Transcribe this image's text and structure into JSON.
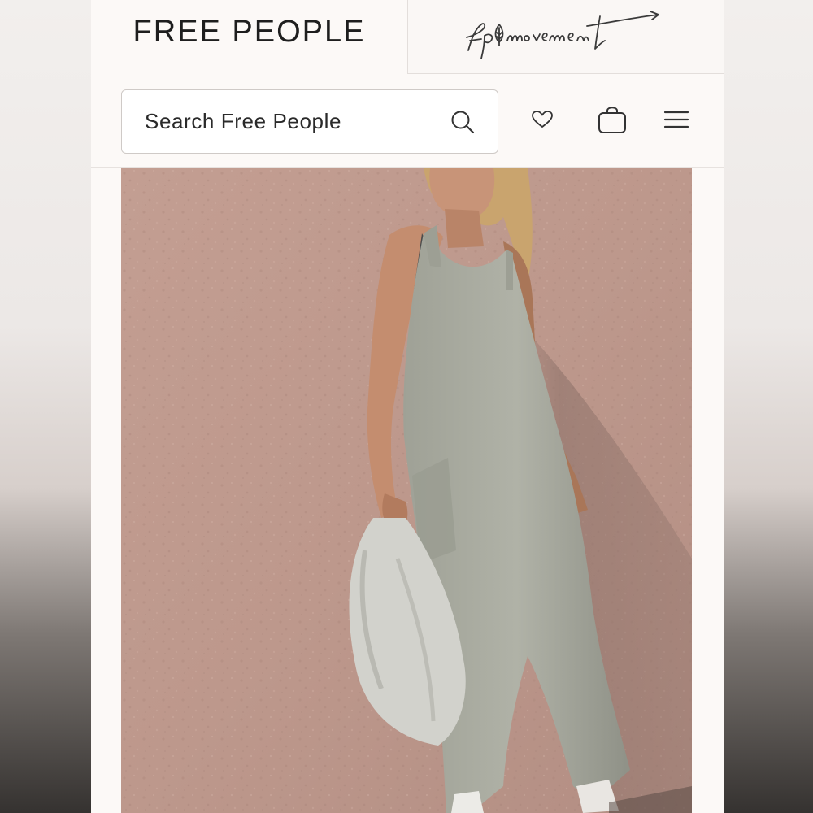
{
  "brand": {
    "main_logo": "FREE PEOPLE",
    "secondary_logo": "fp movement"
  },
  "search": {
    "placeholder": "Search Free People"
  },
  "icons": {
    "search": "search-icon",
    "wishlist": "heart-icon",
    "bag": "shopping-bag-icon",
    "menu": "hamburger-menu-icon"
  },
  "hero": {
    "description_subject": "product-photo"
  },
  "colors": {
    "page_background": "#fcf9f7",
    "text": "#1e1e1e",
    "hero_wall": "#c09d92",
    "garment": "#a9ab9f"
  }
}
